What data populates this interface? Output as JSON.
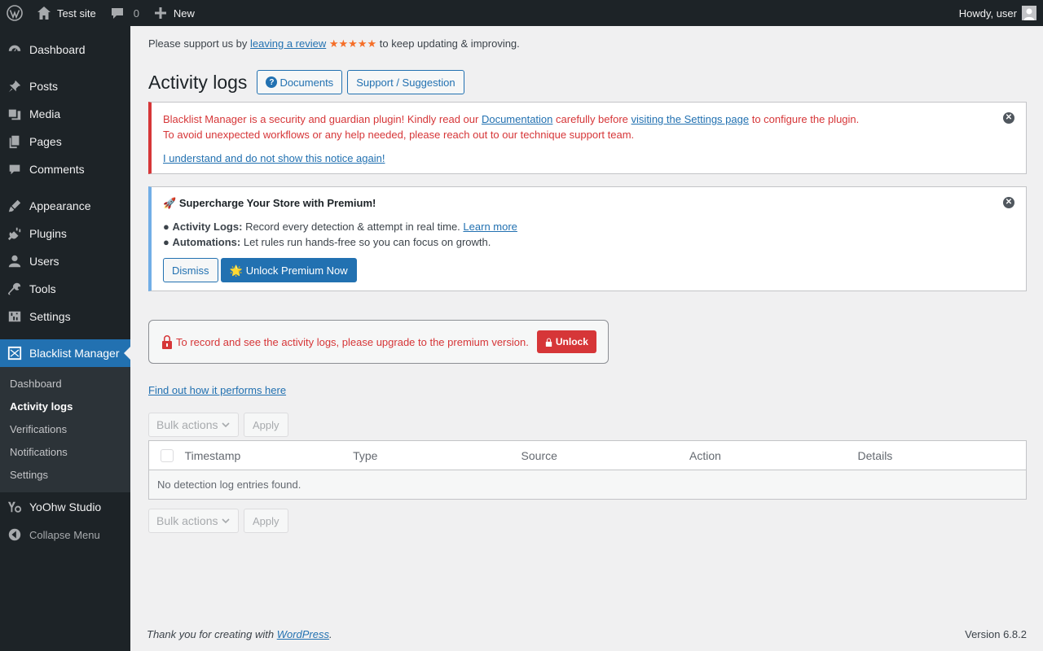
{
  "adminbar": {
    "site_name": "Test site",
    "comments_count": "0",
    "new_label": "New",
    "howdy": "Howdy, user"
  },
  "sidebar": {
    "items": [
      {
        "label": "Dashboard",
        "icon": "dashboard-icon"
      },
      {
        "label": "Posts",
        "icon": "pin-icon"
      },
      {
        "label": "Media",
        "icon": "media-icon"
      },
      {
        "label": "Pages",
        "icon": "pages-icon"
      },
      {
        "label": "Comments",
        "icon": "comment-icon"
      },
      {
        "label": "Appearance",
        "icon": "brush-icon"
      },
      {
        "label": "Plugins",
        "icon": "plug-icon"
      },
      {
        "label": "Users",
        "icon": "user-icon"
      },
      {
        "label": "Tools",
        "icon": "wrench-icon"
      },
      {
        "label": "Settings",
        "icon": "sliders-icon"
      },
      {
        "label": "Blacklist Manager",
        "icon": "blacklist-icon"
      },
      {
        "label": "YoOhw Studio",
        "icon": "yoohw-icon"
      }
    ],
    "submenu": [
      "Dashboard",
      "Activity logs",
      "Verifications",
      "Notifications",
      "Settings"
    ],
    "collapse": "Collapse Menu"
  },
  "support": {
    "prefix": "Please support us by",
    "link": "leaving a review",
    "stars": "★★★★★",
    "suffix": "to keep updating & improving."
  },
  "page": {
    "title": "Activity logs",
    "documents_btn": "Documents",
    "support_btn": "Support / Suggestion"
  },
  "error_notice": {
    "t1": "Blacklist Manager is a security and guardian plugin! Kindly read our",
    "link1": "Documentation",
    "t2": "carefully before",
    "link2": "visiting the Settings page",
    "t3": "to configure the plugin.",
    "line2": "To avoid unexpected workflows or any help needed, please reach out to our technique support team.",
    "ack_link": "I understand and do not show this notice again!"
  },
  "premium_notice": {
    "heading": "Supercharge Your Store with Premium!",
    "item1_bold": "Activity Logs:",
    "item1_text": "Record every detection & attempt in real time.",
    "item1_link": "Learn more",
    "item2_bold": "Automations:",
    "item2_text": "Let rules run hands-free so you can focus on growth.",
    "dismiss": "Dismiss",
    "unlock_now": "Unlock Premium Now"
  },
  "lockbox": {
    "text": "To record and see the activity logs, please upgrade to the premium version.",
    "button": "Unlock"
  },
  "findout": "Find out how it performs here",
  "bulk": {
    "select": "Bulk actions",
    "apply": "Apply"
  },
  "table": {
    "columns": [
      "Timestamp",
      "Type",
      "Source",
      "Action",
      "Details"
    ],
    "empty": "No detection log entries found."
  },
  "footer": {
    "thanks": "Thank you for creating with",
    "link": "WordPress",
    "version": "Version 6.8.2"
  },
  "colors": {
    "accent": "#2271b1",
    "error": "#d63638",
    "star": "#f56e28",
    "sidebar_bg": "#1d2327"
  }
}
